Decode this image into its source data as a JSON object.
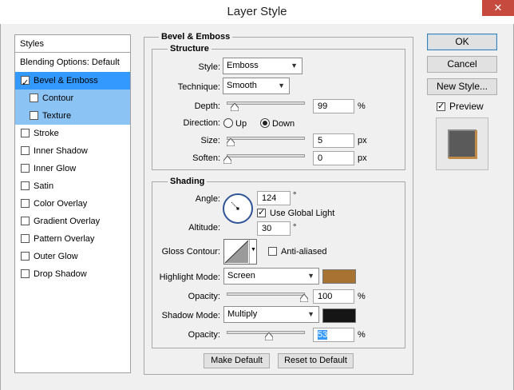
{
  "window": {
    "title": "Layer Style",
    "close": "✕"
  },
  "styles": {
    "header": "Styles",
    "blending": "Blending Options: Default",
    "items": [
      {
        "label": "Bevel & Emboss",
        "checked": true
      },
      {
        "label": "Contour",
        "checked": false
      },
      {
        "label": "Texture",
        "checked": false
      },
      {
        "label": "Stroke",
        "checked": false
      },
      {
        "label": "Inner Shadow",
        "checked": false
      },
      {
        "label": "Inner Glow",
        "checked": false
      },
      {
        "label": "Satin",
        "checked": false
      },
      {
        "label": "Color Overlay",
        "checked": false
      },
      {
        "label": "Gradient Overlay",
        "checked": false
      },
      {
        "label": "Pattern Overlay",
        "checked": false
      },
      {
        "label": "Outer Glow",
        "checked": false
      },
      {
        "label": "Drop Shadow",
        "checked": false
      }
    ]
  },
  "bevel": {
    "title": "Bevel & Emboss",
    "structure": {
      "title": "Structure",
      "style_label": "Style:",
      "style_value": "Emboss",
      "technique_label": "Technique:",
      "technique_value": "Smooth",
      "depth_label": "Depth:",
      "depth_value": "99",
      "depth_unit": "%",
      "direction_label": "Direction:",
      "direction_up": "Up",
      "direction_down": "Down",
      "size_label": "Size:",
      "size_value": "5",
      "size_unit": "px",
      "soften_label": "Soften:",
      "soften_value": "0",
      "soften_unit": "px"
    },
    "shading": {
      "title": "Shading",
      "angle_label": "Angle:",
      "angle_value": "124",
      "angle_unit": "°",
      "global_light_label": "Use Global Light",
      "global_light_checked": true,
      "altitude_label": "Altitude:",
      "altitude_value": "30",
      "altitude_unit": "°",
      "gloss_label": "Gloss Contour:",
      "anti_aliased_label": "Anti-aliased",
      "highlight_mode_label": "Highlight Mode:",
      "highlight_mode_value": "Screen",
      "highlight_color": "#a87232",
      "highlight_opacity_label": "Opacity:",
      "highlight_opacity_value": "100",
      "highlight_opacity_unit": "%",
      "shadow_mode_label": "Shadow Mode:",
      "shadow_mode_value": "Multiply",
      "shadow_color": "#151515",
      "shadow_opacity_label": "Opacity:",
      "shadow_opacity_value": "53",
      "shadow_opacity_unit": "%"
    },
    "make_default": "Make Default",
    "reset_default": "Reset to Default"
  },
  "buttons": {
    "ok": "OK",
    "cancel": "Cancel",
    "new_style": "New Style...",
    "preview_label": "Preview",
    "preview_checked": true
  }
}
